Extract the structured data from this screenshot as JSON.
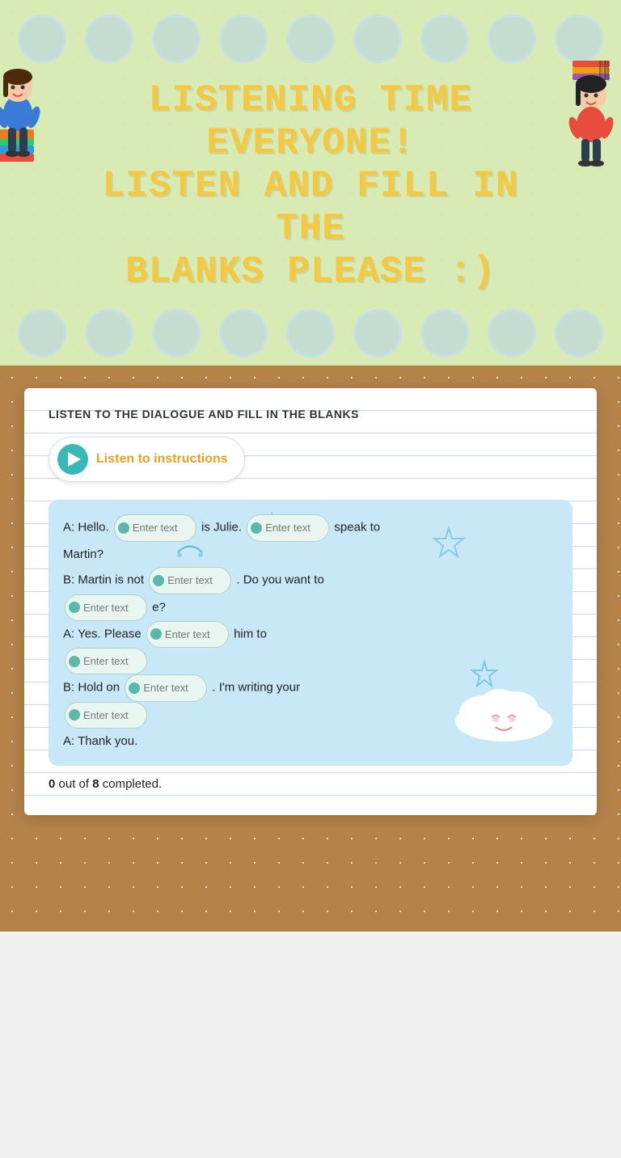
{
  "header": {
    "title_line1": "LISTENING TIME EVERYONE!",
    "title_line2": "LISTEN AND FILL IN THE",
    "title_line3": "BLANKS PLEASE :)"
  },
  "worksheet": {
    "title": "LISTEN TO THE DIALOGUE AND FILL IN THE BLANKS",
    "audio_button_label": "Listen to instructions",
    "dialogue": {
      "line1_prefix": "A: Hello.",
      "line1_mid": "is Julie.",
      "line1_end": "speak to",
      "line1_suffix": "Martin?",
      "line2_prefix": "B: Martin is not",
      "line2_mid": ". Do you want to",
      "line2_end_partial": "e?",
      "line3_prefix": "A: Yes. Please",
      "line3_mid": "him to",
      "line4_prefix": "B: Hold on",
      "line4_mid": ". I'm writing your",
      "line5": "A: Thank you."
    },
    "inputs": [
      {
        "id": "input1",
        "placeholder": "Enter text"
      },
      {
        "id": "input2",
        "placeholder": "Enter text"
      },
      {
        "id": "input3",
        "placeholder": "Enter text"
      },
      {
        "id": "input4",
        "placeholder": "Enter text"
      },
      {
        "id": "input5",
        "placeholder": "Enter text"
      },
      {
        "id": "input6",
        "placeholder": "Enter text"
      },
      {
        "id": "input7",
        "placeholder": "Enter text"
      },
      {
        "id": "input8",
        "placeholder": "Enter text"
      }
    ],
    "score": {
      "current": "0",
      "total": "8",
      "label": "completed."
    }
  },
  "colors": {
    "teal": "#3ab8b8",
    "orange": "#e8a020",
    "yellow_title": "#f5c842",
    "blue_dialogue_bg": "#c8e8f8",
    "input_bg": "#e8f5f0",
    "input_border": "#aad4c8",
    "input_dot": "#5cb8a8"
  }
}
